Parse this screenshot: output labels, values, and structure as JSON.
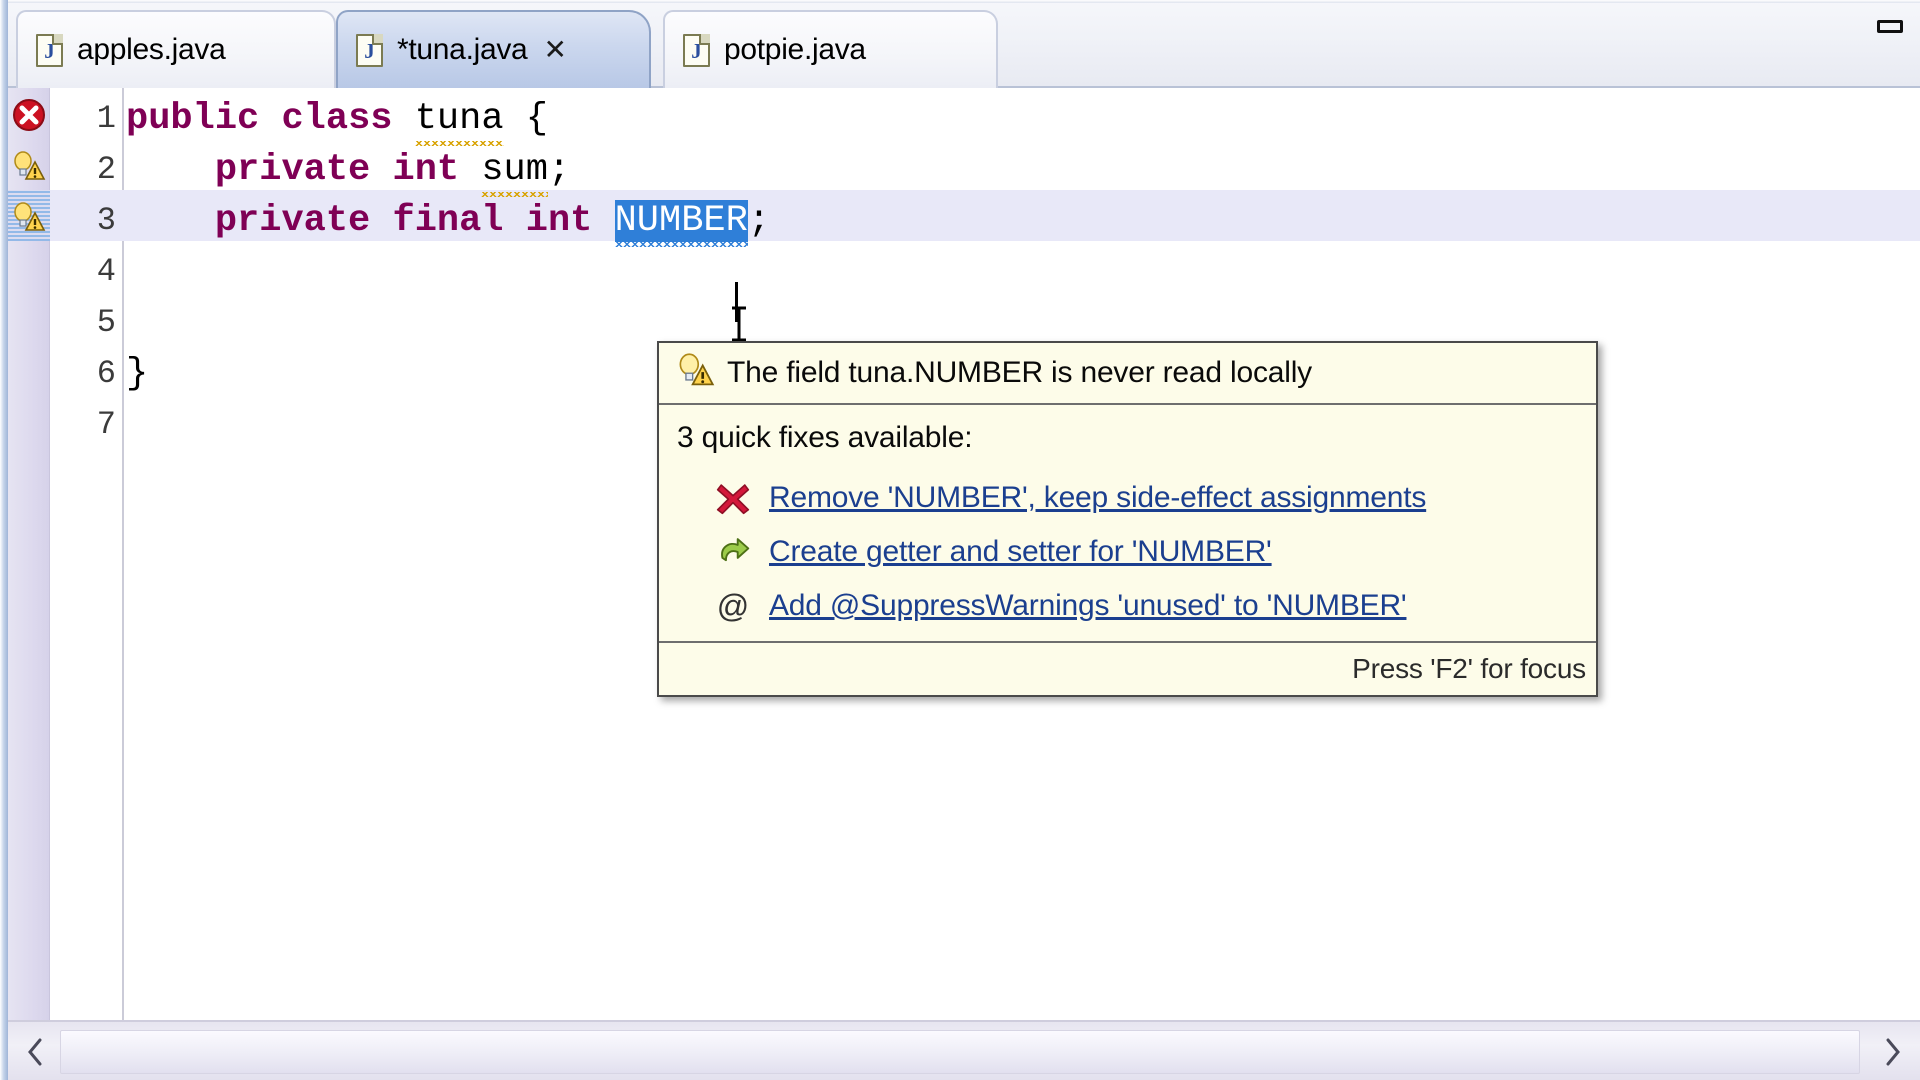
{
  "window": {
    "control_icon": "restore-window-icon"
  },
  "tabs": [
    {
      "label": "apples.java",
      "icon": "java-file-icon",
      "active": false,
      "dirty": false,
      "closable": false
    },
    {
      "label": "*tuna.java",
      "icon": "java-file-icon",
      "active": true,
      "dirty": true,
      "closable": true,
      "close_glyph": "✕"
    },
    {
      "label": "potpie.java",
      "icon": "java-file-icon",
      "active": false,
      "dirty": false,
      "closable": false
    }
  ],
  "editor": {
    "file": "tuna.java",
    "lines": [
      {
        "number": "1",
        "marker": "error-marker-icon",
        "segments": [
          {
            "text": "public",
            "style": "keyword"
          },
          {
            "text": " ",
            "style": "plain"
          },
          {
            "text": "class",
            "style": "keyword"
          },
          {
            "text": " ",
            "style": "plain"
          },
          {
            "text": "tuna",
            "style": "squiggly"
          },
          {
            "text": " {",
            "style": "plain"
          }
        ]
      },
      {
        "number": "2",
        "marker": "warning-marker-icon",
        "segments": [
          {
            "text": "    ",
            "style": "plain"
          },
          {
            "text": "private",
            "style": "keyword"
          },
          {
            "text": " ",
            "style": "plain"
          },
          {
            "text": "int",
            "style": "keyword"
          },
          {
            "text": " ",
            "style": "plain"
          },
          {
            "text": "sum",
            "style": "squiggly"
          },
          {
            "text": ";",
            "style": "plain"
          }
        ]
      },
      {
        "number": "3",
        "marker": "warning-marker-selected-icon",
        "highlighted": true,
        "segments": [
          {
            "text": "    ",
            "style": "plain"
          },
          {
            "text": "private",
            "style": "keyword"
          },
          {
            "text": " ",
            "style": "plain"
          },
          {
            "text": "final",
            "style": "keyword"
          },
          {
            "text": " ",
            "style": "plain"
          },
          {
            "text": "int",
            "style": "keyword"
          },
          {
            "text": " ",
            "style": "plain"
          },
          {
            "text": "NUMBER",
            "style": "selected"
          },
          {
            "text": ";",
            "style": "plain"
          }
        ]
      },
      {
        "number": "4",
        "marker": null,
        "segments": []
      },
      {
        "number": "5",
        "marker": null,
        "segments": []
      },
      {
        "number": "6",
        "marker": null,
        "segments": [
          {
            "text": "}",
            "style": "plain"
          }
        ]
      },
      {
        "number": "7",
        "marker": null,
        "segments": []
      }
    ],
    "selected_text": "NUMBER"
  },
  "tooltip": {
    "icon": "warning-lightbulb-icon",
    "message": "The field tuna.NUMBER is never read locally",
    "count_label": "3 quick fixes available:",
    "fixes": [
      {
        "icon": "delete-x-icon",
        "label": "Remove 'NUMBER', keep side-effect assignments"
      },
      {
        "icon": "green-arrow-icon",
        "label": "Create getter and setter for 'NUMBER'"
      },
      {
        "icon": "annotation-at-icon",
        "label": "Add @SuppressWarnings 'unused' to 'NUMBER'"
      }
    ],
    "footer": "Press 'F2' for focus"
  },
  "scrollbar": {
    "left_arrow": "scroll-left-arrow-icon",
    "right_arrow": "scroll-right-arrow-icon"
  },
  "colors": {
    "keyword": "#7f0055",
    "selection": "#2f7fd8",
    "link": "#1b3f8f",
    "tooltip_bg": "#fdfce9",
    "line_highlight": "#e8e8f8",
    "error": "#cc1122",
    "warning": "#f2c94c"
  }
}
